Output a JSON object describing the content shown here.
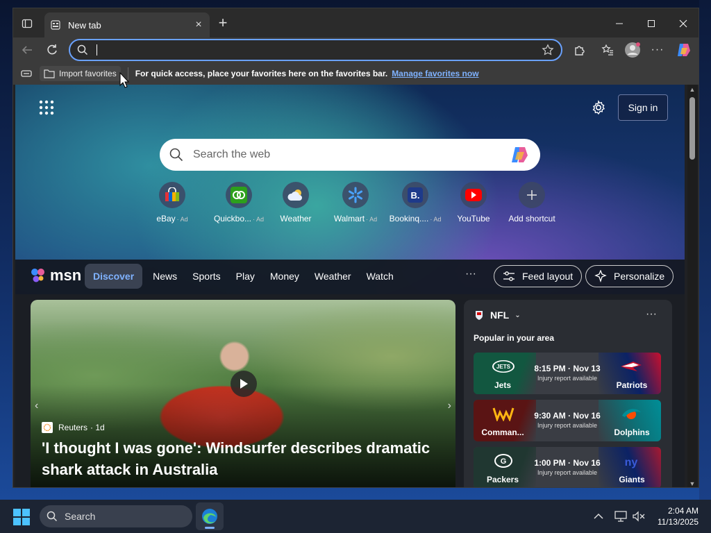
{
  "browser": {
    "tab_title": "New tab",
    "address_value": "",
    "favorites_bar": {
      "import_label": "Import favorites",
      "message": "For quick access, place your favorites here on the favorites bar.",
      "link": "Manage favorites now"
    }
  },
  "newtab": {
    "signin_label": "Sign in",
    "search_placeholder": "Search the web",
    "shortcuts": [
      {
        "label": "eBay",
        "ad": "· Ad",
        "icon": "ebay-icon"
      },
      {
        "label": "Quickbo...",
        "ad": "· Ad",
        "icon": "quickbooks-icon"
      },
      {
        "label": "Weather",
        "ad": "",
        "icon": "weather-icon"
      },
      {
        "label": "Walmart",
        "ad": "· Ad",
        "icon": "walmart-icon"
      },
      {
        "label": "Bookinq....",
        "ad": "· Ad",
        "icon": "booking-icon"
      },
      {
        "label": "YouTube",
        "ad": "",
        "icon": "youtube-icon"
      },
      {
        "label": "Add shortcut",
        "ad": "",
        "icon": "plus-icon"
      }
    ]
  },
  "msn": {
    "logo_text": "msn",
    "nav": [
      "Discover",
      "News",
      "Sports",
      "Play",
      "Money",
      "Weather",
      "Watch"
    ],
    "more": "···",
    "feed_layout_label": "Feed layout",
    "personalize_label": "Personalize",
    "hero": {
      "source": "Reuters",
      "age": "· 1d",
      "headline": "'I thought I was gone': Windsurfer describes dramatic shark attack in Australia"
    },
    "nfl": {
      "title": "NFL",
      "subtitle": "Popular in your area",
      "games": [
        {
          "home": "Jets",
          "away": "Patriots",
          "time": "8:15 PM · Nov 13",
          "note": "Injury report available"
        },
        {
          "home": "Comman...",
          "away": "Dolphins",
          "time": "9:30 AM · Nov 16",
          "note": "Injury report available"
        },
        {
          "home": "Packers",
          "away": "Giants",
          "time": "1:00 PM · Nov 16",
          "note": "Injury report available"
        }
      ]
    }
  },
  "taskbar": {
    "search_label": "Search",
    "time": "2:04 AM",
    "date": "11/13/2025"
  },
  "colors": {
    "accent": "#7fb2ff",
    "address_border": "#6aa2ff"
  }
}
